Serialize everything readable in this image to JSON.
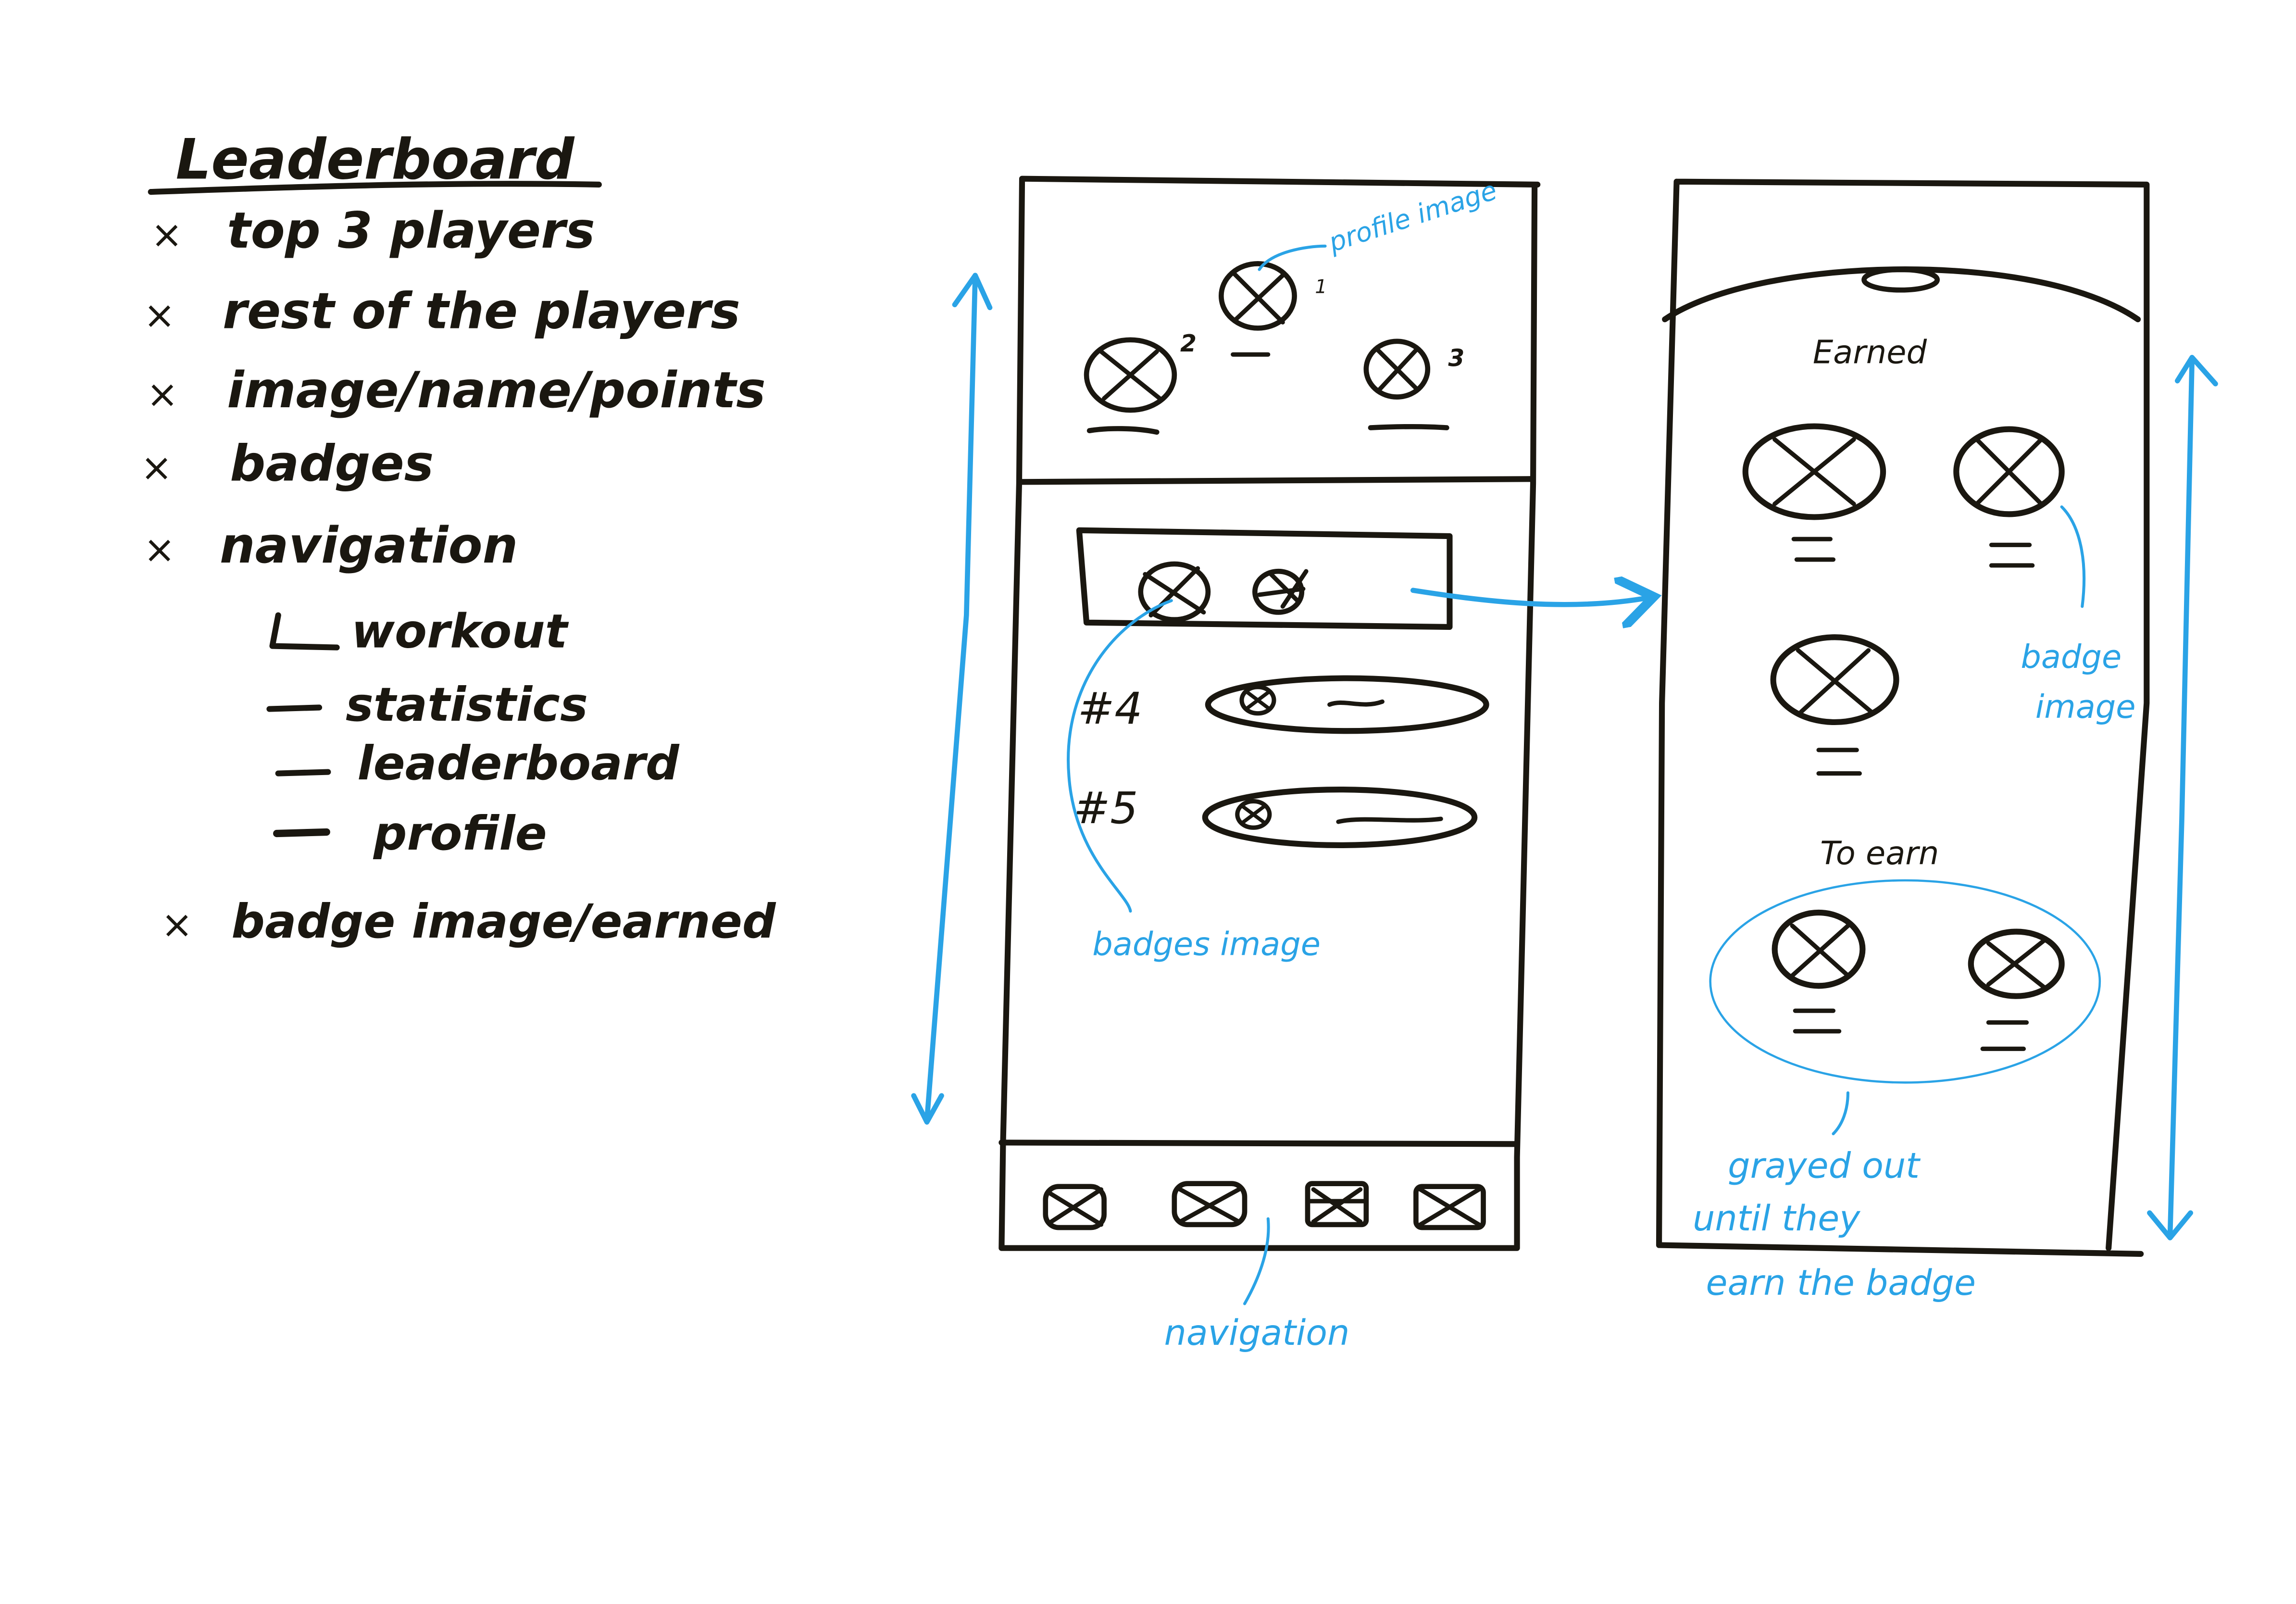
{
  "notes": {
    "title": "Leaderboard",
    "items": [
      "top 3 players",
      "rest of the players",
      "image/name/points",
      "badges",
      "navigation"
    ],
    "nav_sub_items": [
      "workout",
      "statistics",
      "leaderboard",
      "profile"
    ],
    "last_item": "badge image/earned"
  },
  "leaderboard_screen": {
    "podium_ranks": [
      "1",
      "2",
      "3"
    ],
    "row_ranks": [
      "#4",
      "#5"
    ],
    "annotations": {
      "profile_image": "profile image",
      "badges_image": "badges image",
      "navigation": "navigation"
    }
  },
  "badges_screen": {
    "earned_heading": "Earned",
    "to_earn_heading": "To earn",
    "annotations": {
      "badge_image": "badge image",
      "grayed_out": "grayed out until they earn the badge"
    }
  },
  "colors": {
    "ink": "#1a1710",
    "annotation": "#2aa3e6"
  }
}
